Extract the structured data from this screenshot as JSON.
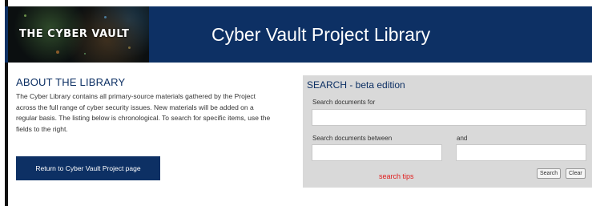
{
  "header": {
    "logo_text": "THE CYBER VAULT",
    "title": "Cyber Vault Project Library"
  },
  "about": {
    "heading": "ABOUT THE LIBRARY",
    "lines": [
      "The Cyber Library contains all primary-source materials gathered by the Project",
      "across the full range of cyber security issues. New materials will be added on a",
      "regular basis. The listing below is chronological. To search for specific items, use the",
      "fields to the right."
    ],
    "return_button": "Return to Cyber Vault Project page"
  },
  "search": {
    "title": "SEARCH - beta edition",
    "documents_for_label": "Search documents for",
    "documents_for_value": "",
    "between_label": "Search documents between",
    "between_value": "",
    "and_label": "and",
    "and_value": "",
    "tips_link": "search tips",
    "search_button": "Search",
    "clear_button": "Clear"
  },
  "colors": {
    "brand_navy": "#0d3064",
    "panel_gray": "#d9d9d9",
    "tips_red": "#e02020"
  }
}
